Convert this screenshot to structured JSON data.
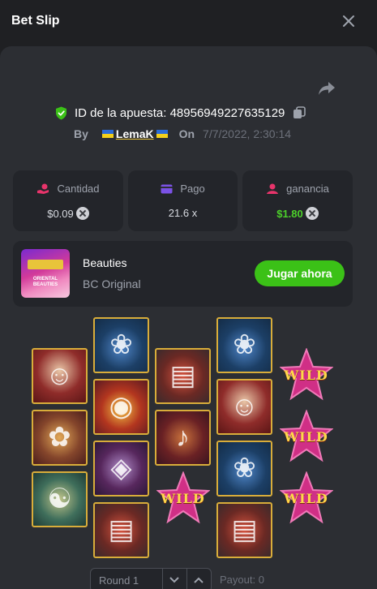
{
  "header": {
    "title": "Bet Slip"
  },
  "bet": {
    "id_label": "ID de la apuesta: 48956949227635129",
    "by_label": "By",
    "user_name": "LemaK",
    "on_label": "On",
    "date": "7/7/2022, 2:30:14"
  },
  "stats": {
    "amount": {
      "label": "Cantidad",
      "value": "$0.09"
    },
    "payout": {
      "label": "Pago",
      "value": "21.6 x"
    },
    "profit": {
      "label": "ganancia",
      "value": "$1.80"
    }
  },
  "game": {
    "name": "Beauties",
    "provider": "BC Original",
    "play_label": "Jugar ahora",
    "thumb_text": "ORIENTAL BEAUTIES"
  },
  "reels": {
    "wild_text": "WILD",
    "columns": [
      [
        "lady",
        "comb",
        "jade"
      ],
      [
        "lotus",
        "gold",
        "fan",
        "book"
      ],
      [
        "book",
        "lute",
        "wild"
      ],
      [
        "lotus",
        "lady",
        "lotus",
        "book"
      ],
      [
        "wild",
        "wild",
        "wild"
      ]
    ]
  },
  "footer": {
    "round_label": "Round 1",
    "payout_label": "Payout: 0"
  },
  "colors": {
    "accent_green": "#3bc117",
    "profit_green": "#4cd12a",
    "panel": "#2c2e33",
    "card": "#23252a",
    "tile_border": "#d9ad3a"
  }
}
